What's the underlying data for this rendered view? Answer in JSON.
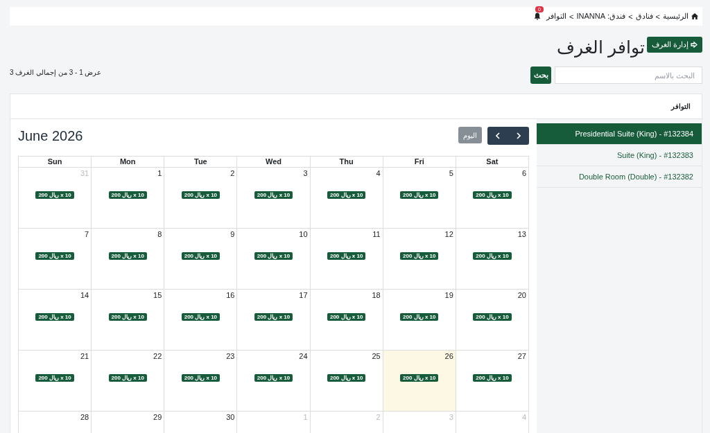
{
  "breadcrumb": [
    {
      "kind": "home",
      "label": "الرئيسية"
    },
    {
      "kind": "separator",
      "label": "<"
    },
    {
      "kind": "link",
      "label": "فنادق"
    },
    {
      "kind": "separator",
      "label": "<"
    },
    {
      "kind": "link",
      "label": "فندق: INANNA"
    },
    {
      "kind": "separator",
      "label": "<"
    },
    {
      "kind": "current",
      "label": "التوافر"
    }
  ],
  "notifications": {
    "count": "0"
  },
  "page": {
    "title": "توافر الغرف",
    "manage_button": "إدارة الغرف"
  },
  "search": {
    "placeholder": "البحث بالاسم",
    "button": "بحث"
  },
  "summary": "عرض 1 - 3 من إجمالي الغرف 3",
  "card": {
    "title": "التوافر"
  },
  "rooms": [
    {
      "label": "Presidential Suite (King) - #132384",
      "selected": true
    },
    {
      "label": "Suite (King) - #132383",
      "selected": false
    },
    {
      "label": "Double Room (Double) - #132382",
      "selected": false
    }
  ],
  "calendar": {
    "title": "June 2026",
    "today_button": "اليوم",
    "weekdays": [
      "Sat",
      "Fri",
      "Thu",
      "Wed",
      "Tue",
      "Mon",
      "Sun"
    ],
    "weeks": [
      [
        {
          "day": "6",
          "muted": false,
          "today": false,
          "event": "200 ريال x 10"
        },
        {
          "day": "5",
          "muted": false,
          "today": false,
          "event": "200 ريال x 10"
        },
        {
          "day": "4",
          "muted": false,
          "today": false,
          "event": "200 ريال x 10"
        },
        {
          "day": "3",
          "muted": false,
          "today": false,
          "event": "200 ريال x 10"
        },
        {
          "day": "2",
          "muted": false,
          "today": false,
          "event": "200 ريال x 10"
        },
        {
          "day": "1",
          "muted": false,
          "today": false,
          "event": "200 ريال x 10"
        },
        {
          "day": "31",
          "muted": true,
          "today": false,
          "event": "200 ريال x 10"
        }
      ],
      [
        {
          "day": "13",
          "muted": false,
          "today": false,
          "event": "200 ريال x 10"
        },
        {
          "day": "12",
          "muted": false,
          "today": false,
          "event": "200 ريال x 10"
        },
        {
          "day": "11",
          "muted": false,
          "today": false,
          "event": "200 ريال x 10"
        },
        {
          "day": "10",
          "muted": false,
          "today": false,
          "event": "200 ريال x 10"
        },
        {
          "day": "9",
          "muted": false,
          "today": false,
          "event": "200 ريال x 10"
        },
        {
          "day": "8",
          "muted": false,
          "today": false,
          "event": "200 ريال x 10"
        },
        {
          "day": "7",
          "muted": false,
          "today": false,
          "event": "200 ريال x 10"
        }
      ],
      [
        {
          "day": "20",
          "muted": false,
          "today": false,
          "event": "200 ريال x 10"
        },
        {
          "day": "19",
          "muted": false,
          "today": false,
          "event": "200 ريال x 10"
        },
        {
          "day": "18",
          "muted": false,
          "today": false,
          "event": "200 ريال x 10"
        },
        {
          "day": "17",
          "muted": false,
          "today": false,
          "event": "200 ريال x 10"
        },
        {
          "day": "16",
          "muted": false,
          "today": false,
          "event": "200 ريال x 10"
        },
        {
          "day": "15",
          "muted": false,
          "today": false,
          "event": "200 ريال x 10"
        },
        {
          "day": "14",
          "muted": false,
          "today": false,
          "event": "200 ريال x 10"
        }
      ],
      [
        {
          "day": "27",
          "muted": false,
          "today": false,
          "event": "200 ريال x 10"
        },
        {
          "day": "26",
          "muted": false,
          "today": true,
          "event": "200 ريال x 10"
        },
        {
          "day": "25",
          "muted": false,
          "today": false,
          "event": "200 ريال x 10"
        },
        {
          "day": "24",
          "muted": false,
          "today": false,
          "event": "200 ريال x 10"
        },
        {
          "day": "23",
          "muted": false,
          "today": false,
          "event": "200 ريال x 10"
        },
        {
          "day": "22",
          "muted": false,
          "today": false,
          "event": "200 ريال x 10"
        },
        {
          "day": "21",
          "muted": false,
          "today": false,
          "event": "200 ريال x 10"
        }
      ],
      [
        {
          "day": "4",
          "muted": true,
          "today": false
        },
        {
          "day": "3",
          "muted": true,
          "today": false
        },
        {
          "day": "2",
          "muted": true,
          "today": false
        },
        {
          "day": "1",
          "muted": true,
          "today": false
        },
        {
          "day": "30",
          "muted": false,
          "today": false
        },
        {
          "day": "29",
          "muted": false,
          "today": false
        },
        {
          "day": "28",
          "muted": false,
          "today": false
        }
      ]
    ]
  }
}
